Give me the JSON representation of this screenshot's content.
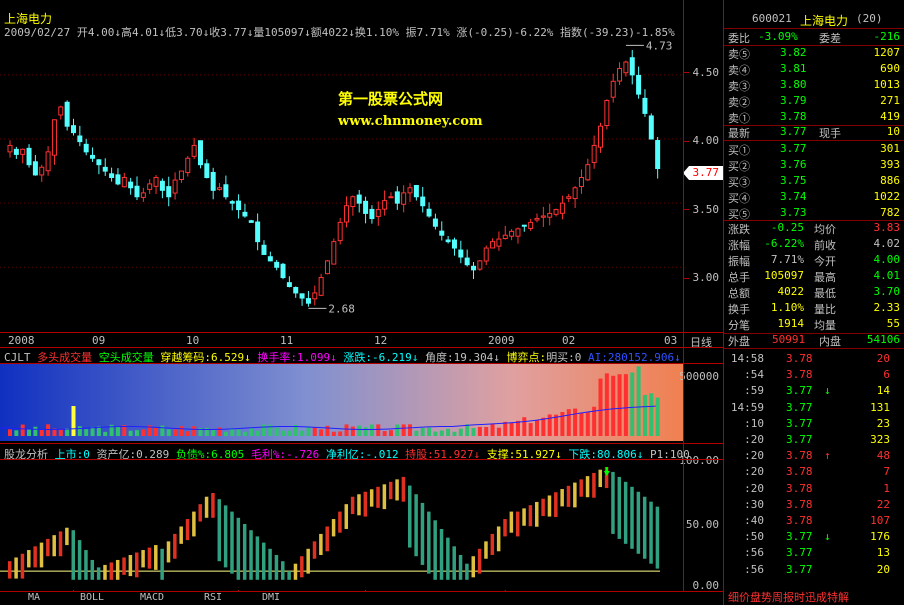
{
  "header": {
    "title": "上海电力",
    "info": [
      {
        "text": "2009/02/27",
        "color": "#c0c0c0"
      },
      {
        "text": " 开4.00↓",
        "color": "#c0c0c0"
      },
      {
        "text": "高4.01↓",
        "color": "#c0c0c0"
      },
      {
        "text": "低3.70↓",
        "color": "#c0c0c0"
      },
      {
        "text": "收3.77↓",
        "color": "#c0c0c0"
      },
      {
        "text": "量105097↓",
        "color": "#c0c0c0"
      },
      {
        "text": "额4022↓",
        "color": "#c0c0c0"
      },
      {
        "text": "换1.10%",
        "color": "#c0c0c0"
      },
      {
        "text": " 振7.71%",
        "color": "#c0c0c0"
      },
      {
        "text": " 涨(-0.25)-6.22%",
        "color": "#c0c0c0"
      },
      {
        "text": " 指数(-39.23)-1.85%",
        "color": "#c0c0c0"
      }
    ],
    "watermark1": "第一股票公式网",
    "watermark2": "www.chnmoney.com"
  },
  "chart_data": [
    {
      "type": "candlestick",
      "title": "上海电力",
      "y_ticks": [
        "4.50",
        "4.00",
        "3.50",
        "3.00"
      ],
      "y_range": [
        2.55,
        4.85
      ],
      "high_label": "4.73",
      "low_label": "2.68",
      "current_price_label": "3.77",
      "x_labels": [
        "2008",
        "09",
        "10",
        "11",
        "12",
        "2009",
        "02",
        "03"
      ],
      "closes": [
        3.95,
        3.88,
        3.92,
        3.8,
        3.72,
        3.78,
        3.9,
        4.15,
        4.25,
        4.1,
        4.05,
        3.98,
        3.9,
        3.85,
        3.8,
        3.75,
        3.7,
        3.65,
        3.7,
        3.62,
        3.55,
        3.58,
        3.65,
        3.7,
        3.6,
        3.55,
        3.68,
        3.75,
        3.85,
        3.95,
        3.8,
        3.7,
        3.6,
        3.62,
        3.55,
        3.5,
        3.45,
        3.4,
        3.35,
        3.2,
        3.1,
        3.05,
        3.0,
        2.92,
        2.85,
        2.8,
        2.76,
        2.72,
        2.8,
        2.92,
        3.05,
        3.2,
        3.35,
        3.48,
        3.55,
        3.5,
        3.42,
        3.38,
        3.45,
        3.52,
        3.55,
        3.5,
        3.58,
        3.62,
        3.55,
        3.48,
        3.4,
        3.32,
        3.25,
        3.2,
        3.15,
        3.08,
        3.02,
        2.98,
        3.05,
        3.15,
        3.2,
        3.22,
        3.25,
        3.28,
        3.3,
        3.32,
        3.35,
        3.38,
        3.4,
        3.42,
        3.45,
        3.5,
        3.55,
        3.62,
        3.7,
        3.8,
        3.95,
        4.1,
        4.3,
        4.45,
        4.55,
        4.6,
        4.5,
        4.35,
        4.2,
        4.0,
        3.77
      ],
      "volume_y_tick": "500000"
    },
    {
      "type": "bar",
      "title": "股龙分析",
      "y_ticks": [
        "100.00",
        "50.00",
        "0.00"
      ]
    }
  ],
  "indicator1": {
    "items": [
      {
        "text": "CJLT",
        "color": "#c0c0c0"
      },
      {
        "text": " 多头成交量",
        "color": "#ff3030"
      },
      {
        "text": " 空头成交量",
        "color": "#00ff00"
      },
      {
        "text": " 穿越筹码:6.529↓",
        "color": "#ffff00"
      },
      {
        "text": " 换手率:1.099↓",
        "color": "#ff00ff"
      },
      {
        "text": " 涨跌:-6.219↓",
        "color": "#00ffff"
      },
      {
        "text": " 角度:19.304↓",
        "color": "#c0c0c0"
      },
      {
        "text": " 博弈点:",
        "color": "#ffff00"
      },
      {
        "text": "明买:0",
        "color": "#c0c0c0"
      },
      {
        "text": " AI:280152.906↓",
        "color": "#3050ff"
      }
    ]
  },
  "indicator2": {
    "items": [
      {
        "text": "股龙分析",
        "color": "#c0c0c0"
      },
      {
        "text": " 上市:0",
        "color": "#00ffff"
      },
      {
        "text": " 资产亿:0.289",
        "color": "#c0c0c0"
      },
      {
        "text": " 负债%:6.805",
        "color": "#00ff00"
      },
      {
        "text": " 毛利%:-.726",
        "color": "#ff00ff"
      },
      {
        "text": " 净利亿:-.012",
        "color": "#00ffff"
      },
      {
        "text": " 持股:51.927↓",
        "color": "#ff3030"
      },
      {
        "text": " 支撑:51.927↓",
        "color": "#ffff00"
      },
      {
        "text": " 下跌:80.806↓",
        "color": "#00ffff"
      },
      {
        "text": " P1:100",
        "color": "#c0c0c0"
      }
    ]
  },
  "bottom_tabs": [
    "MA",
    "BOLL",
    "MACD",
    "RSI",
    "DMI"
  ],
  "day_line_label": "日线",
  "quote": {
    "code": "600021",
    "name": "上海电力",
    "count": "(20)",
    "wei_bi_label": "委比",
    "wei_bi": "-3.09%",
    "wei_cha_label": "委差",
    "wei_cha": "-216",
    "sells": [
      {
        "label": "卖⑤",
        "price": "3.82",
        "vol": "1207"
      },
      {
        "label": "卖④",
        "price": "3.81",
        "vol": "690"
      },
      {
        "label": "卖③",
        "price": "3.80",
        "vol": "1013"
      },
      {
        "label": "卖②",
        "price": "3.79",
        "vol": "271"
      },
      {
        "label": "卖①",
        "price": "3.78",
        "vol": "419"
      }
    ],
    "latest_label": "最新",
    "latest": "3.77",
    "now_hand_label": "现手",
    "now_hand": "10",
    "buys": [
      {
        "label": "买①",
        "price": "3.77",
        "vol": "301"
      },
      {
        "label": "买②",
        "price": "3.76",
        "vol": "393"
      },
      {
        "label": "买③",
        "price": "3.75",
        "vol": "886"
      },
      {
        "label": "买④",
        "price": "3.74",
        "vol": "1022"
      },
      {
        "label": "买⑤",
        "price": "3.73",
        "vol": "782"
      }
    ],
    "stats": [
      {
        "l1": "涨跌",
        "v1": "-0.25",
        "c1": "#00ff00",
        "l2": "均价",
        "v2": "3.83",
        "c2": "#ff3030"
      },
      {
        "l1": "涨幅",
        "v1": "-6.22%",
        "c1": "#00ff00",
        "l2": "前收",
        "v2": "4.02",
        "c2": "#c0c0c0"
      },
      {
        "l1": "振幅",
        "v1": "7.71%",
        "c1": "#c0c0c0",
        "l2": "今开",
        "v2": "4.00",
        "c2": "#00ff00"
      },
      {
        "l1": "总手",
        "v1": "105097",
        "c1": "#ffff00",
        "l2": "最高",
        "v2": "4.01",
        "c2": "#00ff00"
      },
      {
        "l1": "总额",
        "v1": "4022",
        "c1": "#ffff00",
        "l2": "最低",
        "v2": "3.70",
        "c2": "#00ff00"
      },
      {
        "l1": "换手",
        "v1": "1.10%",
        "c1": "#ffff00",
        "l2": "量比",
        "v2": "2.33",
        "c2": "#ffff00"
      },
      {
        "l1": "分笔",
        "v1": "1914",
        "c1": "#ffff00",
        "l2": "均量",
        "v2": "55",
        "c2": "#ffff00"
      }
    ],
    "outer_label": "外盘",
    "outer": "50991",
    "inner_label": "内盘",
    "inner": "54106",
    "ticks": [
      {
        "time": "14:58",
        "price": "3.78",
        "vol": "20",
        "arrow": "↓",
        "vc": "#ff3030",
        "ac": "#00ff00"
      },
      {
        "time": ":54",
        "price": "3.78",
        "vol": "6",
        "arrow": "↓",
        "vc": "#ff3030",
        "ac": "#00ff00"
      },
      {
        "time": ":59",
        "price": "3.77",
        "vol": "14",
        "arrow": "↓",
        "vc": "#ffff00",
        "ac": "#00ff00",
        "pa": "↓"
      },
      {
        "time": "14:59",
        "price": "3.77",
        "vol": "131",
        "arrow": "",
        "vc": "#ffff00",
        "ac": "#00ff00"
      },
      {
        "time": ":10",
        "price": "3.77",
        "vol": "23",
        "arrow": "",
        "vc": "#ffff00",
        "ac": "#00ff00"
      },
      {
        "time": ":20",
        "price": "3.77",
        "vol": "323",
        "arrow": "",
        "vc": "#ffff00",
        "ac": "#00ff00"
      },
      {
        "time": ":20",
        "price": "3.78",
        "vol": "48",
        "arrow": "",
        "vc": "#ff3030",
        "ac": "#ff3030",
        "pa": "↑"
      },
      {
        "time": ":20",
        "price": "3.78",
        "vol": "7",
        "arrow": "",
        "vc": "#ff3030",
        "ac": "#ff3030"
      },
      {
        "time": ":20",
        "price": "3.78",
        "vol": "1",
        "arrow": "",
        "vc": "#ff3030",
        "ac": "#ff3030"
      },
      {
        "time": ":30",
        "price": "3.78",
        "vol": "22",
        "arrow": "",
        "vc": "#ff3030",
        "ac": "#ff3030"
      },
      {
        "time": ":40",
        "price": "3.78",
        "vol": "107",
        "arrow": "",
        "vc": "#ff3030",
        "ac": "#ff3030"
      },
      {
        "time": ":50",
        "price": "3.77",
        "vol": "176",
        "arrow": "",
        "vc": "#ffff00",
        "ac": "#00ff00",
        "pa": "↓"
      },
      {
        "time": ":56",
        "price": "3.77",
        "vol": "13",
        "arrow": "",
        "vc": "#ffff00",
        "ac": "#00ff00"
      },
      {
        "time": ":56",
        "price": "3.77",
        "vol": "20",
        "arrow": "",
        "vc": "#ffff00",
        "ac": "#00ff00"
      }
    ],
    "footer": "细价盘势周报时迅成特解"
  }
}
